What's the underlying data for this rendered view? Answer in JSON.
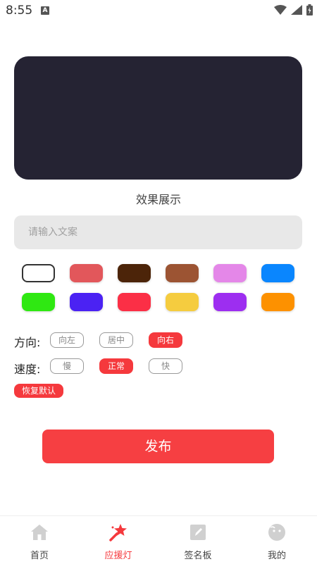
{
  "status_bar": {
    "time": "8:55",
    "notif_icon": "A"
  },
  "preview": {
    "caption": "效果展示"
  },
  "input": {
    "placeholder": "请输入文案",
    "value": ""
  },
  "colors": [
    {
      "name": "white",
      "hex": "#ffffff",
      "selected": true
    },
    {
      "name": "coral",
      "hex": "#e2575b"
    },
    {
      "name": "dark-brown",
      "hex": "#4c2409"
    },
    {
      "name": "brown",
      "hex": "#9c5433"
    },
    {
      "name": "pink",
      "hex": "#e487e8"
    },
    {
      "name": "blue",
      "hex": "#0a86fe"
    },
    {
      "name": "green",
      "hex": "#2fe812"
    },
    {
      "name": "indigo",
      "hex": "#4b22f3"
    },
    {
      "name": "red",
      "hex": "#fb2f46"
    },
    {
      "name": "yellow",
      "hex": "#f5cc3f"
    },
    {
      "name": "purple",
      "hex": "#9d2ef0"
    },
    {
      "name": "orange",
      "hex": "#fd9100"
    }
  ],
  "direction": {
    "label": "方向:",
    "options": [
      "向左",
      "居中",
      "向右"
    ],
    "selected": "向右"
  },
  "speed": {
    "label": "速度:",
    "options": [
      "慢",
      "正常",
      "快"
    ],
    "selected": "正常"
  },
  "reset_label": "恢复默认",
  "publish_label": "发布",
  "tabs": [
    {
      "label": "首页",
      "icon": "home-icon"
    },
    {
      "label": "应援灯",
      "icon": "star-wand-icon",
      "active": true
    },
    {
      "label": "签名板",
      "icon": "signature-pad-icon"
    },
    {
      "label": "我的",
      "icon": "profile-face-icon"
    }
  ],
  "accent": "#f5393d"
}
